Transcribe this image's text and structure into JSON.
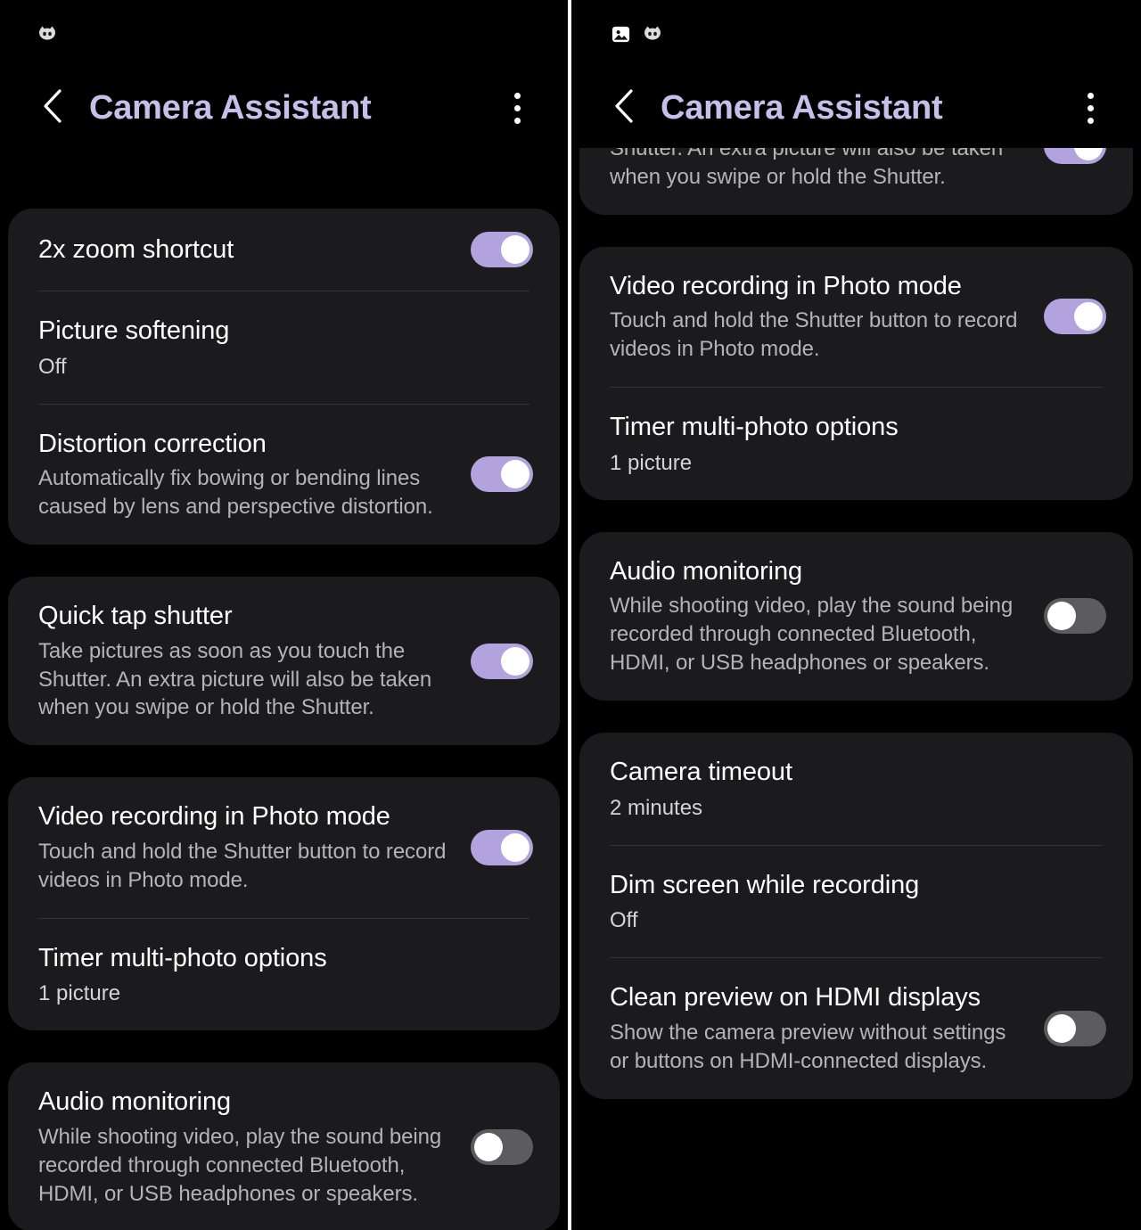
{
  "colors": {
    "background": "#000000",
    "card": "#1b1b1d",
    "title_accent": "#c6bfe9",
    "toggle_on": "#b2a2dd",
    "toggle_off": "#5b5b60",
    "divider": "#333336",
    "primary_text": "#ffffff",
    "secondary_text": "#b4b4b8",
    "panel_split": "#ffffff"
  },
  "left_panel": {
    "statusbar": {
      "icons": [
        {
          "name": "cat-face-notification-icon"
        }
      ]
    },
    "appbar": {
      "back_icon": "chevron-left-icon",
      "title": "Camera Assistant",
      "menu_icon": "more-vertical-icon"
    },
    "groups": [
      {
        "rows": [
          {
            "title": "2x zoom shortcut",
            "description": "",
            "value": "",
            "control": "toggle",
            "state": "on"
          },
          {
            "title": "Picture softening",
            "description": "",
            "value": "Off",
            "control": "none",
            "state": ""
          },
          {
            "title": "Distortion correction",
            "description": "Automatically fix bowing or bending lines caused by lens and perspective distortion.",
            "value": "",
            "control": "toggle",
            "state": "on"
          }
        ]
      },
      {
        "rows": [
          {
            "title": "Quick tap shutter",
            "description": "Take pictures as soon as you touch the Shutter. An extra picture will also be taken when you swipe or hold the Shutter.",
            "value": "",
            "control": "toggle",
            "state": "on"
          }
        ]
      },
      {
        "rows": [
          {
            "title": "Video recording in Photo mode",
            "description": "Touch and hold the Shutter button to record videos in Photo mode.",
            "value": "",
            "control": "toggle",
            "state": "on"
          },
          {
            "title": "Timer multi-photo options",
            "description": "",
            "value": "1 picture",
            "control": "none",
            "state": ""
          }
        ]
      },
      {
        "rows": [
          {
            "title": "Audio monitoring",
            "description": "While shooting video, play the sound being recorded through connected Bluetooth, HDMI, or USB headphones or speakers.",
            "value": "",
            "control": "toggle",
            "state": "off"
          }
        ]
      }
    ]
  },
  "right_panel": {
    "statusbar": {
      "icons": [
        {
          "name": "image-gallery-icon"
        },
        {
          "name": "cat-face-notification-icon"
        }
      ]
    },
    "appbar": {
      "back_icon": "chevron-left-icon",
      "title": "Camera Assistant",
      "menu_icon": "more-vertical-icon"
    },
    "groups": [
      {
        "rows": [
          {
            "title": "",
            "description": "Take pictures as soon as you touch the Shutter. An extra picture will also be taken when you swipe or hold the Shutter.",
            "value": "",
            "control": "toggle",
            "state": "on"
          }
        ]
      },
      {
        "rows": [
          {
            "title": "Video recording in Photo mode",
            "description": "Touch and hold the Shutter button to record videos in Photo mode.",
            "value": "",
            "control": "toggle",
            "state": "on"
          },
          {
            "title": "Timer multi-photo options",
            "description": "",
            "value": "1 picture",
            "control": "none",
            "state": ""
          }
        ]
      },
      {
        "rows": [
          {
            "title": "Audio monitoring",
            "description": "While shooting video, play the sound being recorded through connected Bluetooth, HDMI, or USB headphones or speakers.",
            "value": "",
            "control": "toggle",
            "state": "off"
          }
        ]
      },
      {
        "rows": [
          {
            "title": "Camera timeout",
            "description": "",
            "value": "2 minutes",
            "control": "none",
            "state": ""
          },
          {
            "title": "Dim screen while recording",
            "description": "",
            "value": "Off",
            "control": "none",
            "state": ""
          },
          {
            "title": "Clean preview on HDMI displays",
            "description": "Show the camera preview without settings or buttons on HDMI-connected displays.",
            "value": "",
            "control": "toggle",
            "state": "off"
          }
        ]
      }
    ]
  }
}
